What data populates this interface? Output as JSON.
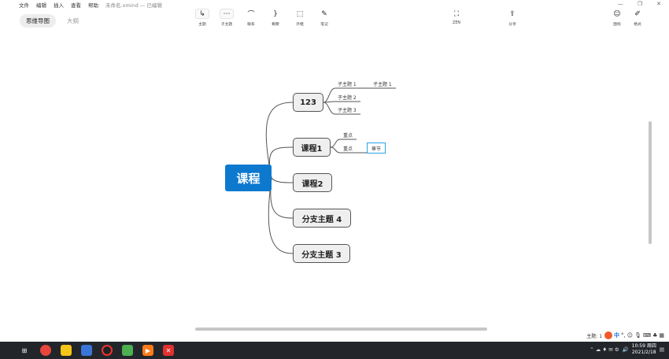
{
  "menu": {
    "file": "文件",
    "edit": "编辑",
    "insert": "插入",
    "view": "查看",
    "help": "帮助",
    "doc_title": "未命名.xmind — 已编辑"
  },
  "tabs": {
    "mindmap": "思维导图",
    "outline": "大纲"
  },
  "toolbar": {
    "topic": "主题",
    "subtopic": "子主题",
    "relation": "联系",
    "summary": "概要",
    "boundary": "外框",
    "note": "笔记",
    "zen": "ZEN",
    "share": "分享",
    "icon": "图标",
    "style": "格式"
  },
  "map": {
    "root": "课程",
    "branch1": "123",
    "branch1_subs": [
      "子主题 1",
      "子主题 2",
      "子主题 3"
    ],
    "branch1_sub1_child": "子主题 1",
    "branch2": "课程1",
    "branch2_subs": [
      "重点",
      "重点"
    ],
    "branch2_sub2_child": "章节",
    "branch3": "课程2",
    "branch4": "分支主题 4",
    "branch5": "分支主题 3"
  },
  "status": {
    "topic_count": "主题: 1",
    "ime_cn": "中"
  },
  "clock": {
    "time": "10:59 周四",
    "date": "2021/2/18"
  },
  "colors": {
    "root": "#0c79cf",
    "selection": "#29a1e6",
    "taskbar": "#22262b"
  }
}
